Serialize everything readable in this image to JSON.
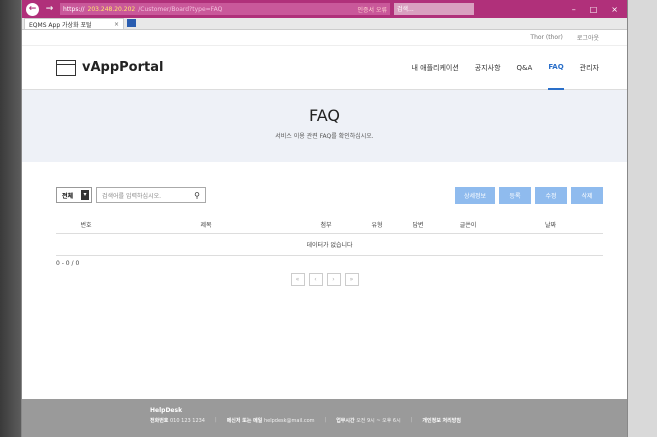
{
  "browser": {
    "url_prefix": "https://",
    "url_host": "203.248.20.202",
    "url_path": "/Customer/Board?type=FAQ",
    "cert_text": "인증서 오류",
    "search_placeholder": "검색...",
    "tab_title": "EQMS App 가상화 포털",
    "tab_close": "×"
  },
  "userbar": {
    "user": "Thor (thor)",
    "logout": "로그아웃"
  },
  "header": {
    "logo_text": "vAppPortal",
    "nav": [
      {
        "label": "내 애플리케이션"
      },
      {
        "label": "공지사항"
      },
      {
        "label": "Q&A"
      },
      {
        "label": "FAQ"
      },
      {
        "label": "관리자"
      }
    ]
  },
  "banner": {
    "title": "FAQ",
    "subtitle": "서비스 이용 관련 FAQ를 확인하십시오."
  },
  "toolbar": {
    "select_value": "전체",
    "search_placeholder": "검색어를 입력하십시오.",
    "buttons": [
      {
        "label": "상세정보"
      },
      {
        "label": "등록"
      },
      {
        "label": "수정"
      },
      {
        "label": "삭제"
      }
    ]
  },
  "table": {
    "columns": [
      "번호",
      "제목",
      "첨부",
      "유형",
      "답변",
      "글쓴이",
      "날짜"
    ],
    "empty_text": "데이터가 없습니다"
  },
  "count_text": "0 - 0 / 0",
  "pager": [
    "«",
    "‹",
    "›",
    "»"
  ],
  "footer": {
    "brand": "HelpDesk",
    "phone_label": "전화번호",
    "phone": "010 123 1234",
    "email_label": "메신저 또는 메일",
    "email": "helpdesk@mail.com",
    "hours_label": "업무시간",
    "hours": "오전 9시 ~ 오후 6시",
    "privacy": "개인정보 처리방침"
  },
  "colors": {
    "browser_accent": "#b0307a",
    "nav_active": "#2a6fc9",
    "button_bg": "#8fbbee",
    "banner_bg": "#eef1f7",
    "footer_bg": "#9a9a9a"
  }
}
